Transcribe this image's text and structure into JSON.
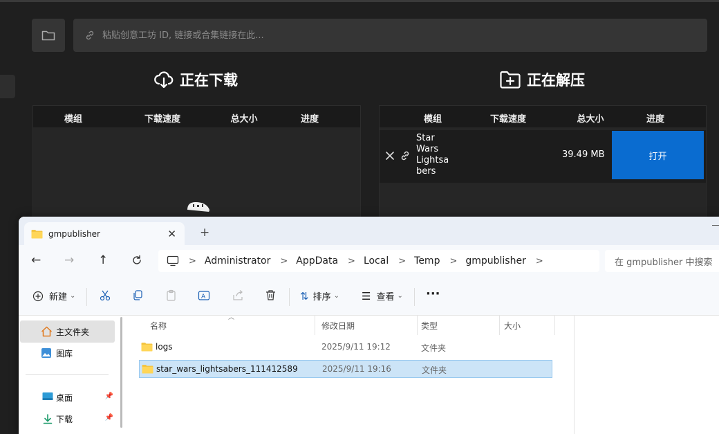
{
  "app": {
    "url_input": {
      "placeholder": "粘贴创意工坊 ID, 链接或合集链接在此..."
    },
    "downloading": {
      "title": "正在下载",
      "columns": [
        "模组",
        "下载速度",
        "总大小",
        "进度"
      ]
    },
    "extracting": {
      "title": "正在解压",
      "columns": [
        "模组",
        "下载速度",
        "总大小",
        "进度"
      ],
      "rows": [
        {
          "name": "Star Wars Lightsabers",
          "name_lines": [
            "Star",
            "Wars",
            "Lightsa",
            "bers"
          ],
          "size": "39.49 MB",
          "action": "打开"
        }
      ]
    },
    "colors": {
      "background": "#1f1f1f",
      "field": "#353535",
      "accent": "#0a6cd0"
    }
  },
  "explorer": {
    "tab": {
      "title": "gmpublisher"
    },
    "breadcrumbs": [
      "Administrator",
      "AppData",
      "Local",
      "Temp",
      "gmpublisher"
    ],
    "search": {
      "placeholder": "在 gmpublisher 中搜索"
    },
    "commands": {
      "new": "新建",
      "sort": "排序",
      "view": "查看",
      "more": "···"
    },
    "nav": {
      "items": [
        {
          "label": "主文件夹",
          "selected": true
        },
        {
          "label": "图库",
          "selected": false
        },
        {
          "label": "桌面",
          "pinned": true
        },
        {
          "label": "下载",
          "pinned": true
        }
      ]
    },
    "columns": {
      "name": "名称",
      "modified": "修改日期",
      "type": "类型",
      "size": "大小"
    },
    "files": [
      {
        "name": "logs",
        "modified": "2025/9/11 19:12",
        "type": "文件夹",
        "size": "",
        "selected": false
      },
      {
        "name": "star_wars_lightsabers_111412589",
        "modified": "2025/9/11 19:16",
        "type": "文件夹",
        "size": "",
        "selected": true
      }
    ],
    "colors": {
      "selection": "#cce4f7",
      "folder": "#f4c542"
    }
  }
}
